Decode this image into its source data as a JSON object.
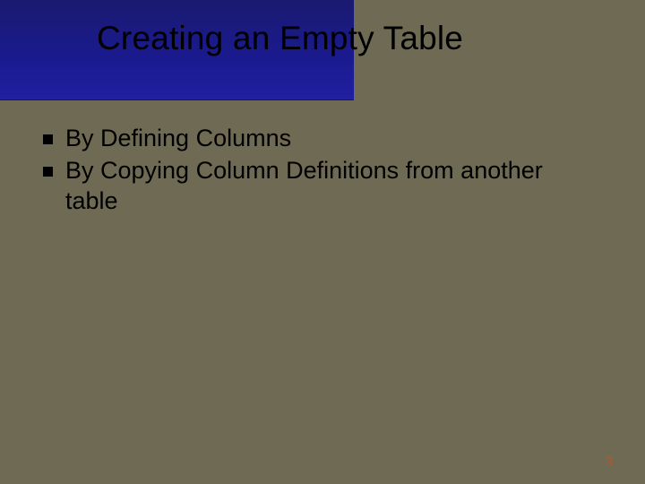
{
  "slide": {
    "title": "Creating an Empty Table",
    "bullets": [
      "By Defining Columns",
      "By Copying Column Definitions from another table"
    ],
    "page_number": "3"
  }
}
